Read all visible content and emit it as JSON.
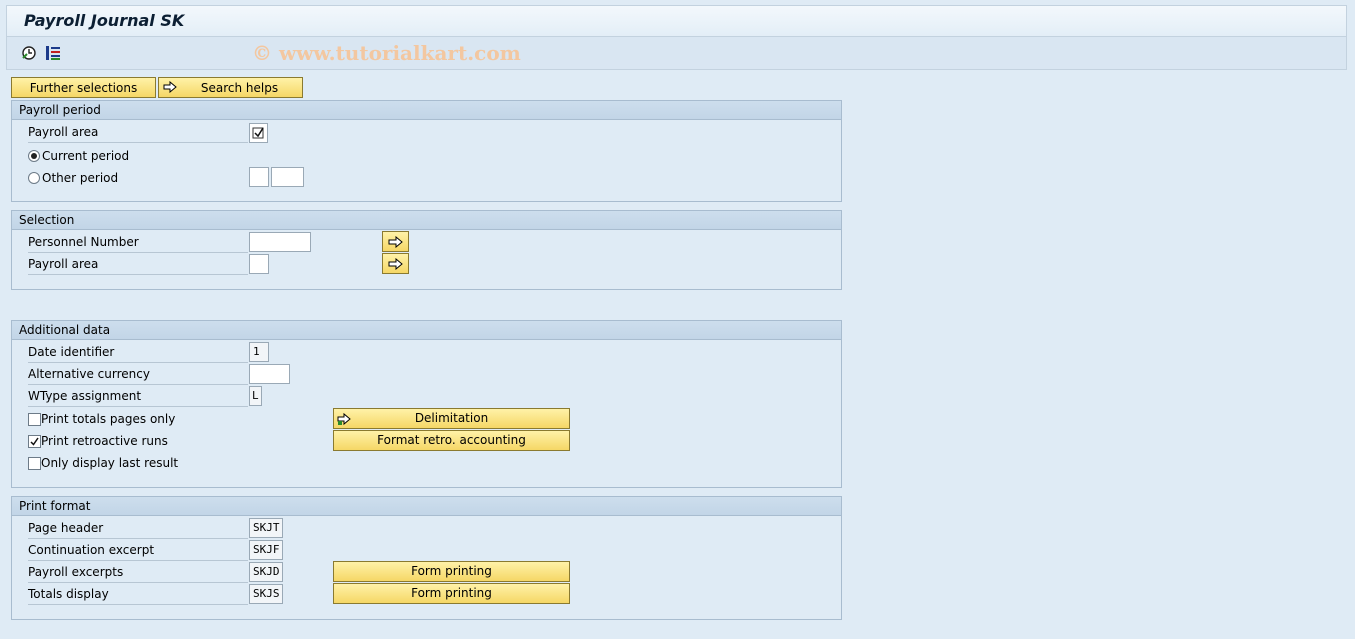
{
  "window": {
    "title": "Payroll Journal SK",
    "watermark": "© www.tutorialkart.com"
  },
  "toolbar": {
    "icons": [
      "execute-clock-icon",
      "program-doc-icon"
    ]
  },
  "top_buttons": {
    "further_selections": "Further selections",
    "search_helps": "Search helps"
  },
  "payroll_period": {
    "title": "Payroll period",
    "payroll_area_label": "Payroll area",
    "payroll_area_checked": true,
    "current_period_label": "Current period",
    "other_period_label": "Other period",
    "selected": "current"
  },
  "selection": {
    "title": "Selection",
    "personnel_number_label": "Personnel Number",
    "personnel_number_value": "",
    "payroll_area_label": "Payroll area",
    "payroll_area_value": ""
  },
  "additional_data": {
    "title": "Additional data",
    "date_identifier_label": "Date identifier",
    "date_identifier_value": "1",
    "alt_currency_label": "Alternative currency",
    "alt_currency_value": "",
    "wtype_label": "WType assignment",
    "wtype_value": "L",
    "print_totals_label": "Print totals pages only",
    "print_totals_checked": false,
    "print_retro_label": "Print retroactive runs",
    "print_retro_checked": true,
    "only_last_label": "Only display last result",
    "only_last_checked": false,
    "delimitation_button": "Delimitation",
    "format_retro_button": "Format retro. accounting"
  },
  "print_format": {
    "title": "Print format",
    "page_header_label": "Page header",
    "page_header_value": "SKJT",
    "continuation_label": "Continuation excerpt",
    "continuation_value": "SKJF",
    "payroll_excerpts_label": "Payroll excerpts",
    "payroll_excerpts_value": "SKJD",
    "totals_display_label": "Totals display",
    "totals_display_value": "SKJS",
    "form_printing_1": "Form printing",
    "form_printing_2": "Form printing"
  },
  "colors": {
    "background": "#dfebf5",
    "button": "#f5d766",
    "group_header": "#c2d5e7"
  }
}
